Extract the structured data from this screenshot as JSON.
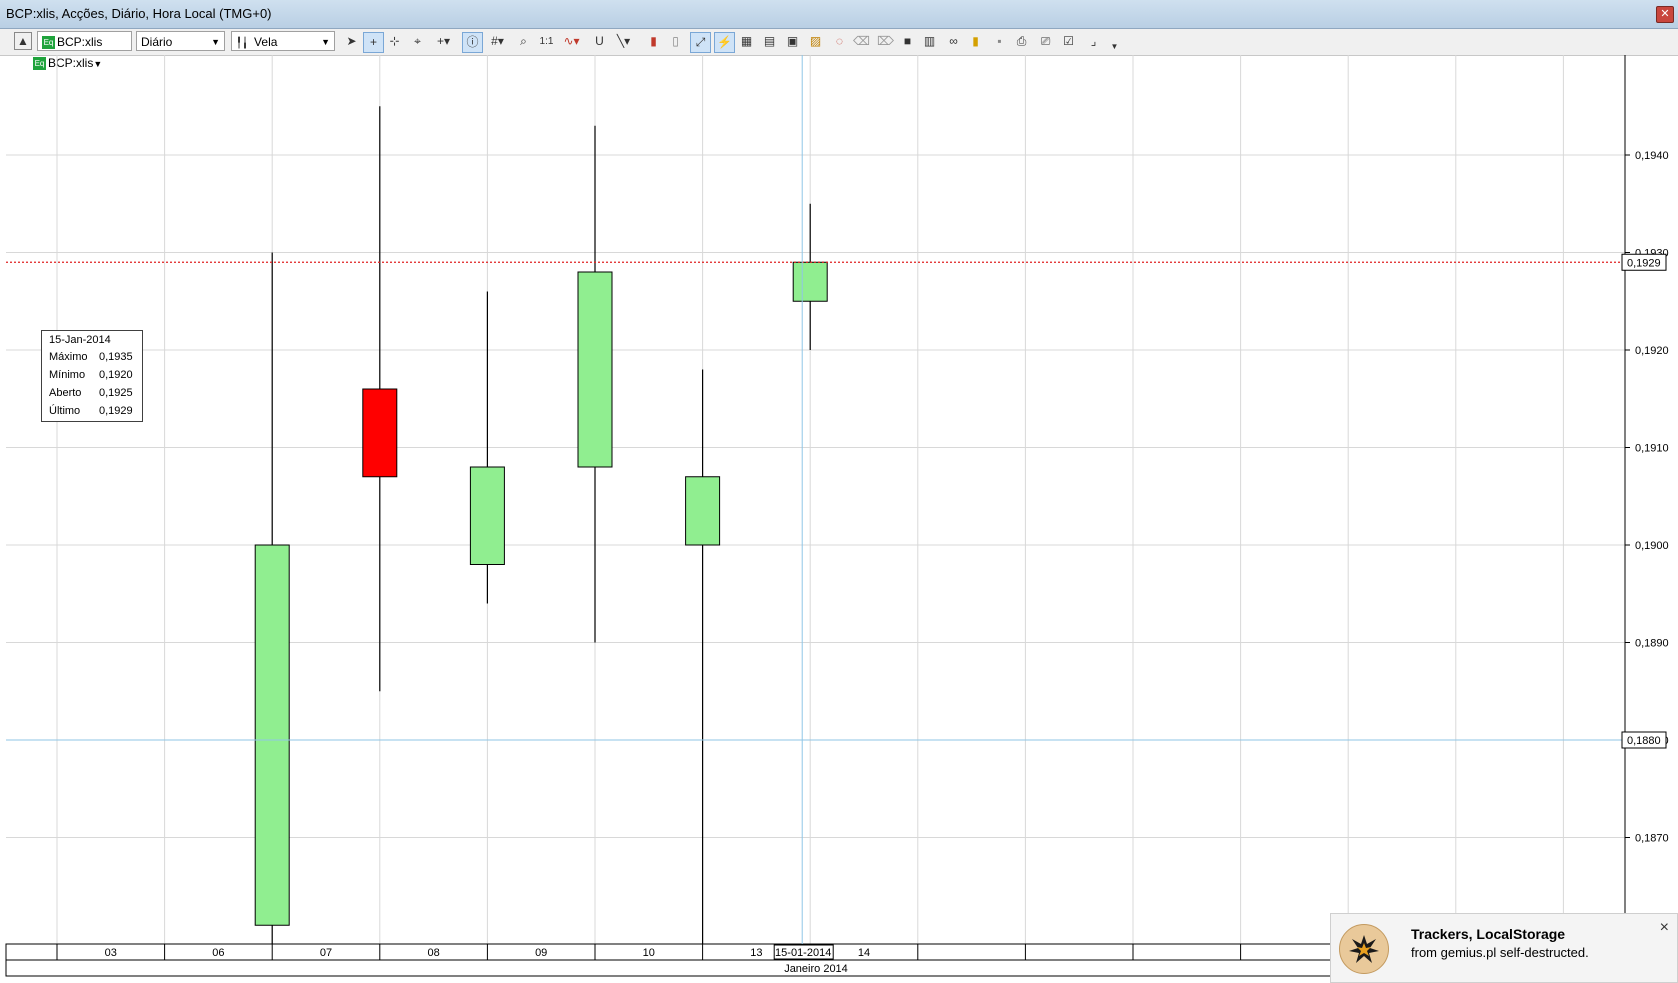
{
  "window": {
    "title": "BCP:xlis, Acções, Diário, Hora Local (TMG+0)"
  },
  "toolbar": {
    "symbol": "BCP:xlis",
    "period": "Diário",
    "chart_type": "Vela",
    "eq_badge": "Eq"
  },
  "chart_header": {
    "symbol": "BCP:xlis"
  },
  "chart_data": {
    "type": "candlestick",
    "categories": [
      "03",
      "06",
      "07",
      "08",
      "09",
      "10",
      "13",
      "14"
    ],
    "candles": [
      {
        "date": "07",
        "open": 0.1861,
        "high": 0.193,
        "low": 0.1858,
        "close": 0.19
      },
      {
        "date": "08",
        "open": 0.1916,
        "high": 0.1945,
        "low": 0.1885,
        "close": 0.1907
      },
      {
        "date": "09",
        "open": 0.1898,
        "high": 0.1926,
        "low": 0.1894,
        "close": 0.1908
      },
      {
        "date": "10",
        "open": 0.1908,
        "high": 0.1943,
        "low": 0.189,
        "close": 0.1928
      },
      {
        "date": "13",
        "open": 0.19,
        "high": 0.1918,
        "low": 0.1858,
        "close": 0.1907
      },
      {
        "date": "14",
        "open": 0.1925,
        "high": 0.1935,
        "low": 0.192,
        "close": 0.1929
      }
    ],
    "y_ticks": [
      "0,1870",
      "0,1880",
      "0,1890",
      "0,1900",
      "0,1910",
      "0,1920",
      "0,1930",
      "0,1940"
    ],
    "ylim": [
      0.1862,
      0.195
    ],
    "x_axis_label": "Janeiro 2014",
    "last_price": {
      "value": 0.1929,
      "label": "0,1929"
    },
    "crosshair": {
      "price": 0.188,
      "price_label": "0,1880",
      "date": "14",
      "date_label": "15-01-2014"
    },
    "up_color": "#90ee90",
    "down_color": "#ff0000",
    "last_price_line_color": "#e02020",
    "crosshair_color": "#8fc6e6",
    "grid": true
  },
  "info_box": {
    "date": "15-Jan-2014",
    "rows": [
      {
        "label": "Máximo",
        "value": "0,1935"
      },
      {
        "label": "Mínimo",
        "value": "0,1920"
      },
      {
        "label": "Aberto",
        "value": "0,1925"
      },
      {
        "label": "Último",
        "value": "0,1929"
      }
    ]
  },
  "notification": {
    "title": "Trackers, LocalStorage",
    "subtitle": "from gemius.pl self-destructed.",
    "close": "×"
  },
  "icons": [
    "collapse-icon",
    "pointer-icon",
    "crosshair-icon",
    "zoom-icon",
    "grid-icon",
    "line-icon",
    "bar-icon",
    "print-icon",
    "save-icon"
  ]
}
